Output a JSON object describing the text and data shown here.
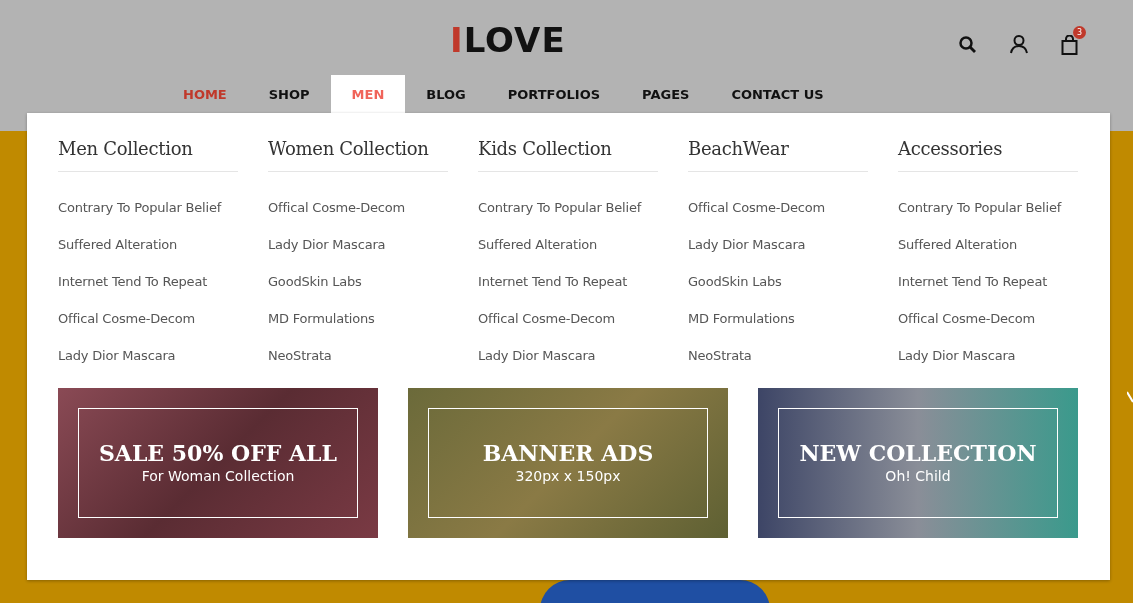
{
  "logo": {
    "accent": "I",
    "text": "LOVE"
  },
  "cart_count": "3",
  "nav": [
    {
      "label": "HOME",
      "active": true,
      "selected": false
    },
    {
      "label": "SHOP",
      "active": false,
      "selected": false
    },
    {
      "label": "MEN",
      "active": false,
      "selected": true
    },
    {
      "label": "BLOG",
      "active": false,
      "selected": false
    },
    {
      "label": "PORTFOLIOS",
      "active": false,
      "selected": false
    },
    {
      "label": "PAGES",
      "active": false,
      "selected": false
    },
    {
      "label": "CONTACT US",
      "active": false,
      "selected": false
    }
  ],
  "mega_menu": {
    "columns": [
      {
        "title": "Men Collection",
        "links": [
          "Contrary To Popular Belief",
          "Suffered Alteration",
          "Internet Tend To Repeat",
          "Offical Cosme-Decom",
          "Lady Dior Mascara"
        ]
      },
      {
        "title": "Women Collection",
        "links": [
          "Offical Cosme-Decom",
          "Lady Dior Mascara",
          "GoodSkin Labs",
          "MD Formulations",
          "NeoStrata"
        ]
      },
      {
        "title": "Kids Collection",
        "links": [
          "Contrary To Popular Belief",
          "Suffered Alteration",
          "Internet Tend To Repeat",
          "Offical Cosme-Decom",
          "Lady Dior Mascara"
        ]
      },
      {
        "title": "BeachWear",
        "links": [
          "Offical Cosme-Decom",
          "Lady Dior Mascara",
          "GoodSkin Labs",
          "MD Formulations",
          "NeoStrata"
        ]
      },
      {
        "title": "Accessories",
        "links": [
          "Contrary To Popular Belief",
          "Suffered Alteration",
          "Internet Tend To Repeat",
          "Offical Cosme-Decom",
          "Lady Dior Mascara"
        ]
      }
    ],
    "banners": [
      {
        "title": "SALE 50% OFF ALL",
        "subtitle": "For Woman Collection"
      },
      {
        "title": "BANNER ADS",
        "subtitle": "320px x 150px"
      },
      {
        "title": "NEW COLLECTION",
        "subtitle": "Oh! Child"
      }
    ]
  }
}
